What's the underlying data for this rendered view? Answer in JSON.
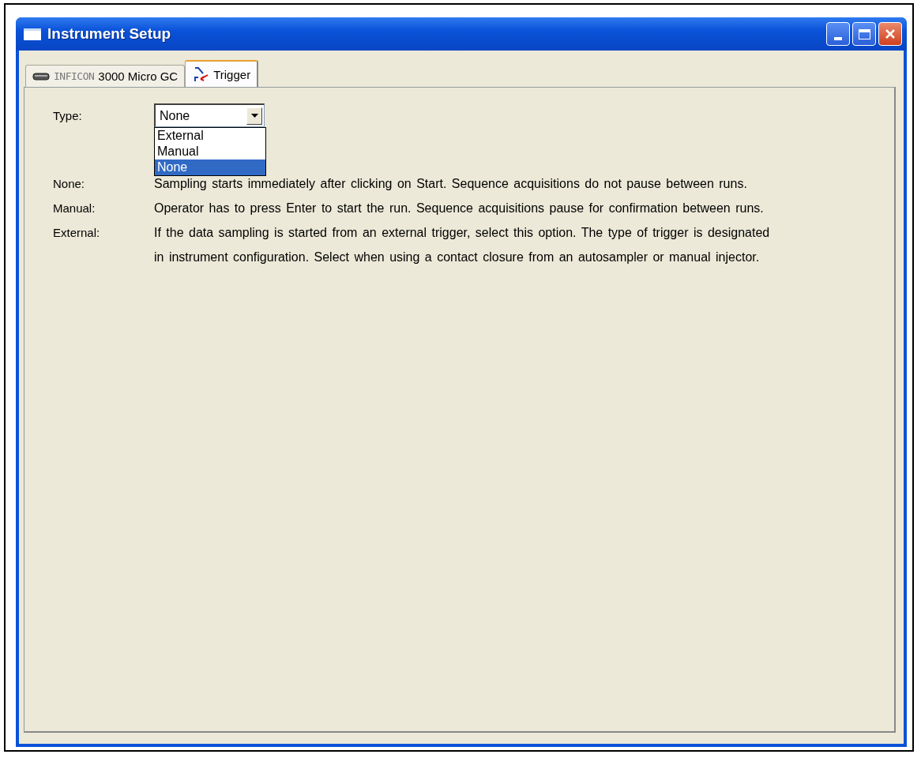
{
  "window": {
    "title": "Instrument Setup"
  },
  "tabs": [
    {
      "brand": "INFICON",
      "label": "3000 Micro GC",
      "kind": "device",
      "selected": false
    },
    {
      "label": "Trigger",
      "kind": "trigger",
      "selected": true
    }
  ],
  "type_field": {
    "label": "Type:",
    "value": "None",
    "expanded": true,
    "options": [
      {
        "label": "External",
        "selected": false
      },
      {
        "label": "Manual",
        "selected": false
      },
      {
        "label": "None",
        "selected": true
      }
    ]
  },
  "descriptions": [
    {
      "term": "None:",
      "lines": [
        "Sampling starts immediately after clicking on Start.  Sequence acquisitions do not pause between runs."
      ]
    },
    {
      "term": "Manual:",
      "lines": [
        "Operator has to press Enter to start the run.  Sequence acquisitions pause for confirmation between runs."
      ]
    },
    {
      "term": "External:",
      "lines": [
        "If the data sampling is started from an external trigger, select this option.  The type of trigger is designated",
        "in instrument configuration.  Select when using a contact closure from an autosampler or manual injector."
      ]
    }
  ]
}
